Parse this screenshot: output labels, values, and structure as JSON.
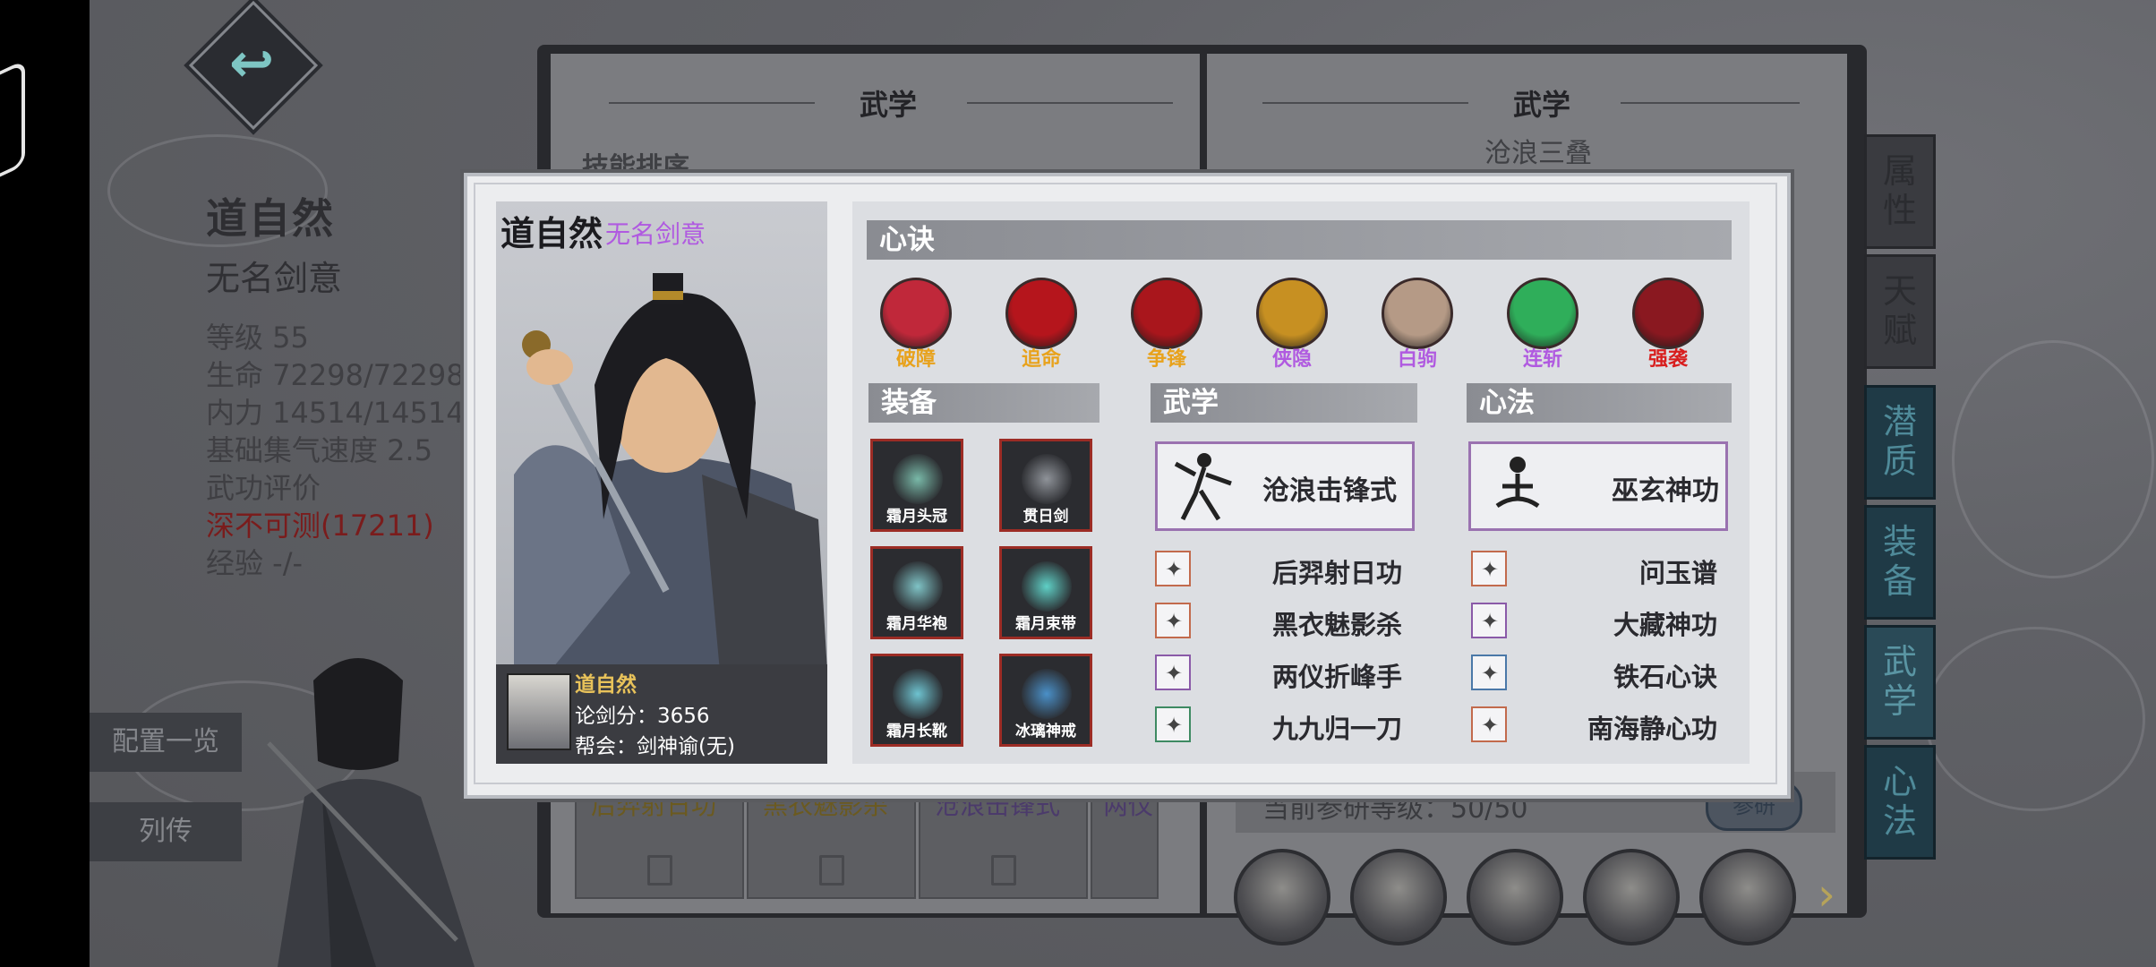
{
  "background": {
    "left_stats": {
      "name": "道自然",
      "title": "无名剑意",
      "lines": [
        "等级 55",
        "生命 72298/72298",
        "内力 14514/14514",
        "基础集气速度 2.5",
        "武功评价"
      ],
      "rating": "深不可测(17211)",
      "exp": "经验 -/-"
    },
    "left_buttons": [
      "配置一览",
      "列传"
    ],
    "left_page": {
      "header": "武学",
      "sort_tab": "技能排序",
      "slots": [
        "后羿射日功",
        "黑衣魅影杀",
        "沧浪击锋式",
        "两仪"
      ]
    },
    "right_page": {
      "header": "武学",
      "subtitle": "沧浪三叠",
      "research_level": "当前参研等级：50/50",
      "research_button": "参研"
    },
    "side_tabs": [
      "属性",
      "天赋",
      "潜质",
      "装备",
      "武学",
      "心法"
    ]
  },
  "popup": {
    "char_name": "道自然",
    "char_title": "无名剑意",
    "info_name": "道自然",
    "info_score": "论剑分：3656",
    "info_guild": "帮会：剑神谕(无)",
    "sections": {
      "xinjue": "心诀",
      "equip": "装备",
      "wuxue": "武学",
      "xinfa": "心法"
    },
    "xinjue": [
      {
        "label": "破障",
        "color": "#e8a21c",
        "icon": "crossed-blades-icon",
        "bg": "#c0283a"
      },
      {
        "label": "追命",
        "color": "#e8a21c",
        "icon": "slash-icon",
        "bg": "#b5151c"
      },
      {
        "label": "争锋",
        "color": "#e8a21c",
        "icon": "crossed-swords-icon",
        "bg": "#a9161c"
      },
      {
        "label": "侠隐",
        "color": "#b05ae0",
        "icon": "silhouette-icon",
        "bg": "#c79022"
      },
      {
        "label": "白驹",
        "color": "#b05ae0",
        "icon": "horse-icon",
        "bg": "#b59a86"
      },
      {
        "label": "连斩",
        "color": "#b05ae0",
        "icon": "combo-slash-icon",
        "bg": "#2fae5a"
      },
      {
        "label": "强袭",
        "color": "#d81e1e",
        "icon": "assault-icon",
        "bg": "#8a1820"
      }
    ],
    "equipment": [
      {
        "name": "霜月头冠",
        "icon": "crown-icon",
        "glow": "#79b9a8"
      },
      {
        "name": "贯日剑",
        "icon": "sword-icon",
        "glow": "#8f9399"
      },
      {
        "name": "霜月华袍",
        "icon": "robe-icon",
        "glow": "#7fc3c6"
      },
      {
        "name": "霜月束带",
        "icon": "belt-icon",
        "glow": "#5fd0c6"
      },
      {
        "name": "霜月长靴",
        "icon": "boots-icon",
        "glow": "#6ec3d0"
      },
      {
        "name": "冰璃神戒",
        "icon": "ring-icon",
        "glow": "#4a90c8"
      }
    ],
    "wuxue_main": "沧浪击锋式",
    "wuxue_list": [
      {
        "label": "后羿射日功",
        "icon": "archer-icon",
        "border": "#c26a4c"
      },
      {
        "label": "黑衣魅影杀",
        "icon": "shadow-dancer-icon",
        "border": "#c26a4c"
      },
      {
        "label": "两仪折峰手",
        "icon": "martial-pose-icon",
        "border": "#8a5aa8"
      },
      {
        "label": "九九归一刀",
        "icon": "blade-stance-icon",
        "border": "#3e8a62"
      }
    ],
    "xinfa_main": "巫玄神功",
    "xinfa_list": [
      {
        "label": "问玉谱",
        "icon": "meditate-icon",
        "border": "#c26a4c"
      },
      {
        "label": "大藏神功",
        "icon": "lotus-icon",
        "border": "#8a5aa8"
      },
      {
        "label": "铁石心诀",
        "icon": "stone-heart-icon",
        "border": "#4a78a8"
      },
      {
        "label": "南海静心功",
        "icon": "calm-icon",
        "border": "#c26a4c"
      }
    ]
  },
  "colors": {
    "accent_purple": "#b05ae0",
    "equip_border": "#9c2c25",
    "tab_teal": "#1f3a46"
  }
}
